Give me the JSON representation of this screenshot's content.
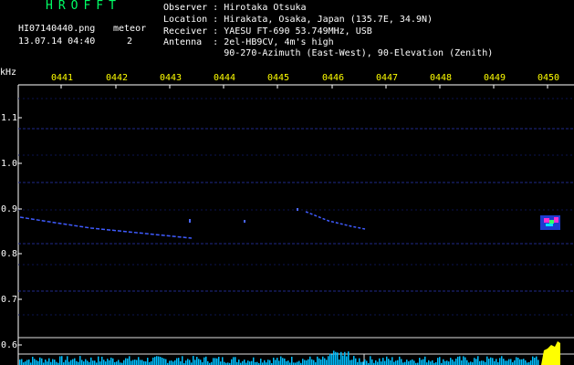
{
  "header": {
    "title": "HROFFT",
    "filename": "HI07140440.png",
    "datetime": "13.07.14 04:40",
    "meteor_label": "meteor",
    "meteor_count": "2",
    "info": {
      "observer": "Observer : Hirotaka Otsuka",
      "location": "Location : Hirakata, Osaka, Japan (135.7E, 34.9N)",
      "receiver": "Receiver : YAESU FT-690 53.749MHz, USB",
      "antenna": "Antenna  : 2el-HB9CV, 4m's high",
      "antenna2": "           90-270-Azimuth (East-West), 90-Elevation (Zenith)"
    }
  },
  "axis": {
    "unit": "kHz",
    "time_ticks": [
      "0441",
      "0442",
      "0443",
      "0444",
      "0445",
      "0446",
      "0447",
      "0448",
      "0449",
      "0450"
    ],
    "freq_ticks": [
      "1.1",
      "1.0",
      "0.9",
      "0.8",
      "0.7",
      "0.6"
    ]
  },
  "colors": {
    "background": "#000000",
    "tick_text": "#ffff00",
    "title_text": "#00ff66",
    "noise_band": "#1a237e",
    "echo": "#3f5bff",
    "spectrum": "#00bfff",
    "burst": "#ffff00"
  }
}
